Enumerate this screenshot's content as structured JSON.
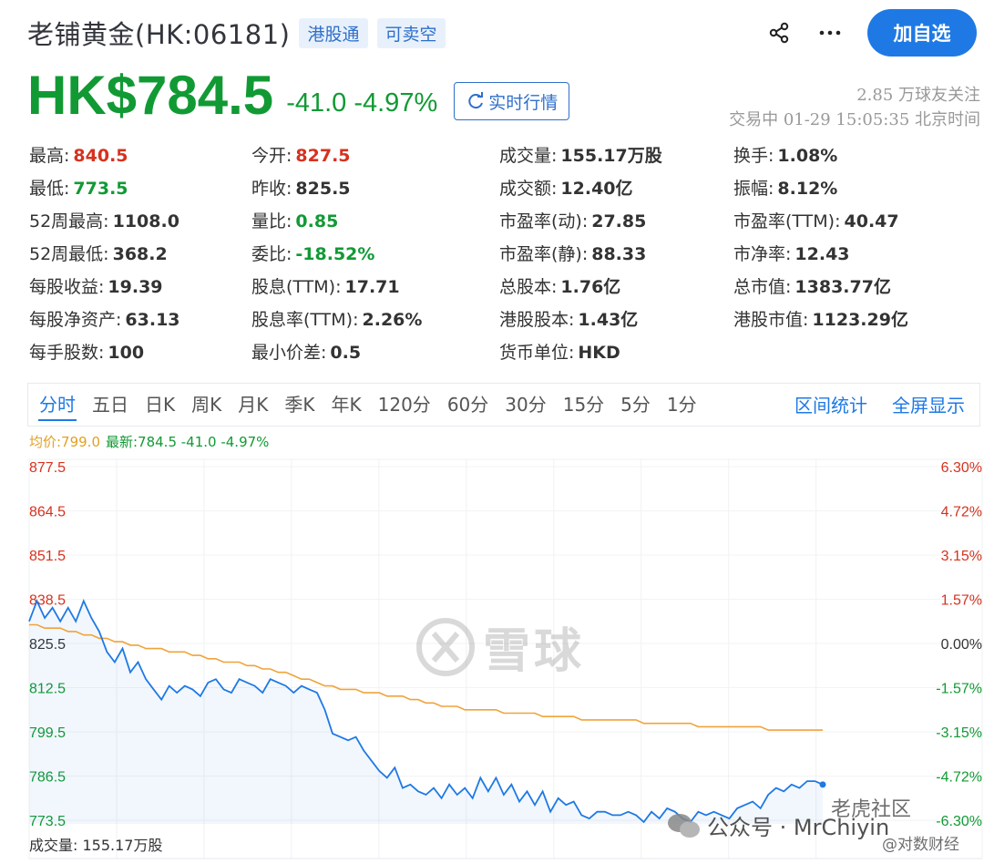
{
  "header": {
    "title": "老铺黄金(HK:06181)",
    "tags": [
      "港股通",
      "可卖空"
    ],
    "add_watchlist": "加自选"
  },
  "quote": {
    "price": "HK$784.5",
    "change": "-41.0 -4.97%",
    "realtime_button": "实时行情",
    "followers": "2.85 万球友关注",
    "status": "交易中 01-29 15:05:35 北京时间"
  },
  "stats": [
    [
      {
        "label": "最高:",
        "value": "840.5",
        "color": "red"
      },
      {
        "label": "今开:",
        "value": "827.5",
        "color": "red"
      },
      {
        "label": "成交量:",
        "value": "155.17万股"
      },
      {
        "label": "换手:",
        "value": "1.08%"
      }
    ],
    [
      {
        "label": "最低:",
        "value": "773.5",
        "color": "green"
      },
      {
        "label": "昨收:",
        "value": "825.5"
      },
      {
        "label": "成交额:",
        "value": "12.40亿"
      },
      {
        "label": "振幅:",
        "value": "8.12%"
      }
    ],
    [
      {
        "label": "52周最高:",
        "value": "1108.0"
      },
      {
        "label": "量比:",
        "value": "0.85",
        "color": "green"
      },
      {
        "label": "市盈率(动):",
        "value": "27.85"
      },
      {
        "label": "市盈率(TTM):",
        "value": "40.47"
      }
    ],
    [
      {
        "label": "52周最低:",
        "value": "368.2"
      },
      {
        "label": "委比:",
        "value": "-18.52%",
        "color": "green"
      },
      {
        "label": "市盈率(静):",
        "value": "88.33"
      },
      {
        "label": "市净率:",
        "value": "12.43"
      }
    ],
    [
      {
        "label": "每股收益:",
        "value": "19.39"
      },
      {
        "label": "股息(TTM):",
        "value": "17.71"
      },
      {
        "label": "总股本:",
        "value": "1.76亿"
      },
      {
        "label": "总市值:",
        "value": "1383.77亿"
      }
    ],
    [
      {
        "label": "每股净资产:",
        "value": "63.13"
      },
      {
        "label": "股息率(TTM):",
        "value": "2.26%"
      },
      {
        "label": "港股股本:",
        "value": "1.43亿"
      },
      {
        "label": "港股市值:",
        "value": "1123.29亿"
      }
    ],
    [
      {
        "label": "每手股数:",
        "value": "100"
      },
      {
        "label": "最小价差:",
        "value": "0.5"
      },
      {
        "label": "货币单位:",
        "value": "HKD"
      }
    ]
  ],
  "tabs": [
    "分时",
    "五日",
    "日K",
    "周K",
    "月K",
    "季K",
    "年K",
    "120分",
    "60分",
    "30分",
    "15分",
    "5分",
    "1分"
  ],
  "tabs_right": [
    "区间统计",
    "全屏显示"
  ],
  "legend": {
    "avg": "均价:799.0",
    "last": "最新:784.5 -41.0 -4.97%"
  },
  "volume_label": "成交量: 155.17万股",
  "watermark": "雪球",
  "brand_texts": [
    "公众号 · MrChiyin",
    "老虎社区",
    "@对数财经"
  ],
  "colors": {
    "up": "#d6321f",
    "down": "#119a34",
    "price_line": "#1e79e4",
    "avg_line": "#f0a33a",
    "accent": "#1e79e4"
  },
  "chart_data": {
    "type": "line",
    "y_ticks_left": [
      "877.5",
      "864.5",
      "851.5",
      "838.5",
      "825.5",
      "812.5",
      "799.5",
      "786.5",
      "773.5"
    ],
    "y_ticks_right": [
      "6.30%",
      "4.72%",
      "3.15%",
      "1.57%",
      "0.00%",
      "-1.57%",
      "-3.15%",
      "-4.72%",
      "-6.30%"
    ],
    "ylim": [
      773.5,
      877.5
    ],
    "prev_close": 825.5,
    "grid": true,
    "series": [
      {
        "name": "最新",
        "color": "#1e79e4",
        "values": [
          832,
          838,
          833,
          836,
          832,
          836,
          832,
          838,
          833,
          829,
          823,
          820,
          824,
          817,
          820,
          815,
          812,
          809,
          813,
          811,
          813,
          812,
          810,
          814,
          815,
          812,
          811,
          815,
          814,
          813,
          811,
          815,
          814,
          813,
          811,
          813,
          812,
          811,
          806,
          799,
          798,
          797,
          798,
          794,
          791,
          788,
          786,
          789,
          783,
          784,
          782,
          781,
          783,
          780,
          784,
          781,
          783,
          780,
          786,
          782,
          786,
          781,
          784,
          779,
          782,
          778,
          782,
          776,
          780,
          778,
          779,
          775,
          774,
          776,
          776,
          775,
          775,
          776,
          775,
          773,
          776,
          774,
          777,
          776,
          774,
          773,
          776,
          775,
          776,
          775,
          774,
          777,
          778,
          779,
          777,
          781,
          783,
          782,
          784,
          783,
          785,
          785,
          784
        ]
      },
      {
        "name": "均价",
        "color": "#f0a33a",
        "values": [
          831,
          831,
          830,
          830,
          830,
          829,
          829,
          828,
          828,
          827,
          827,
          826,
          826,
          825,
          825,
          824,
          824,
          824,
          823,
          823,
          823,
          822,
          822,
          821,
          821,
          820,
          820,
          820,
          819,
          819,
          818,
          818,
          817,
          817,
          816,
          815,
          815,
          814,
          813,
          813,
          812,
          812,
          812,
          811,
          811,
          811,
          810,
          810,
          810,
          809,
          809,
          808,
          808,
          807,
          807,
          807,
          806,
          806,
          806,
          806,
          806,
          805,
          805,
          805,
          805,
          805,
          804,
          804,
          804,
          804,
          804,
          803,
          803,
          803,
          803,
          803,
          803,
          803,
          803,
          802,
          802,
          802,
          802,
          802,
          802,
          802,
          801,
          801,
          801,
          801,
          801,
          801,
          801,
          801,
          801,
          800,
          800,
          800,
          800,
          800,
          800,
          800,
          800
        ]
      }
    ]
  }
}
